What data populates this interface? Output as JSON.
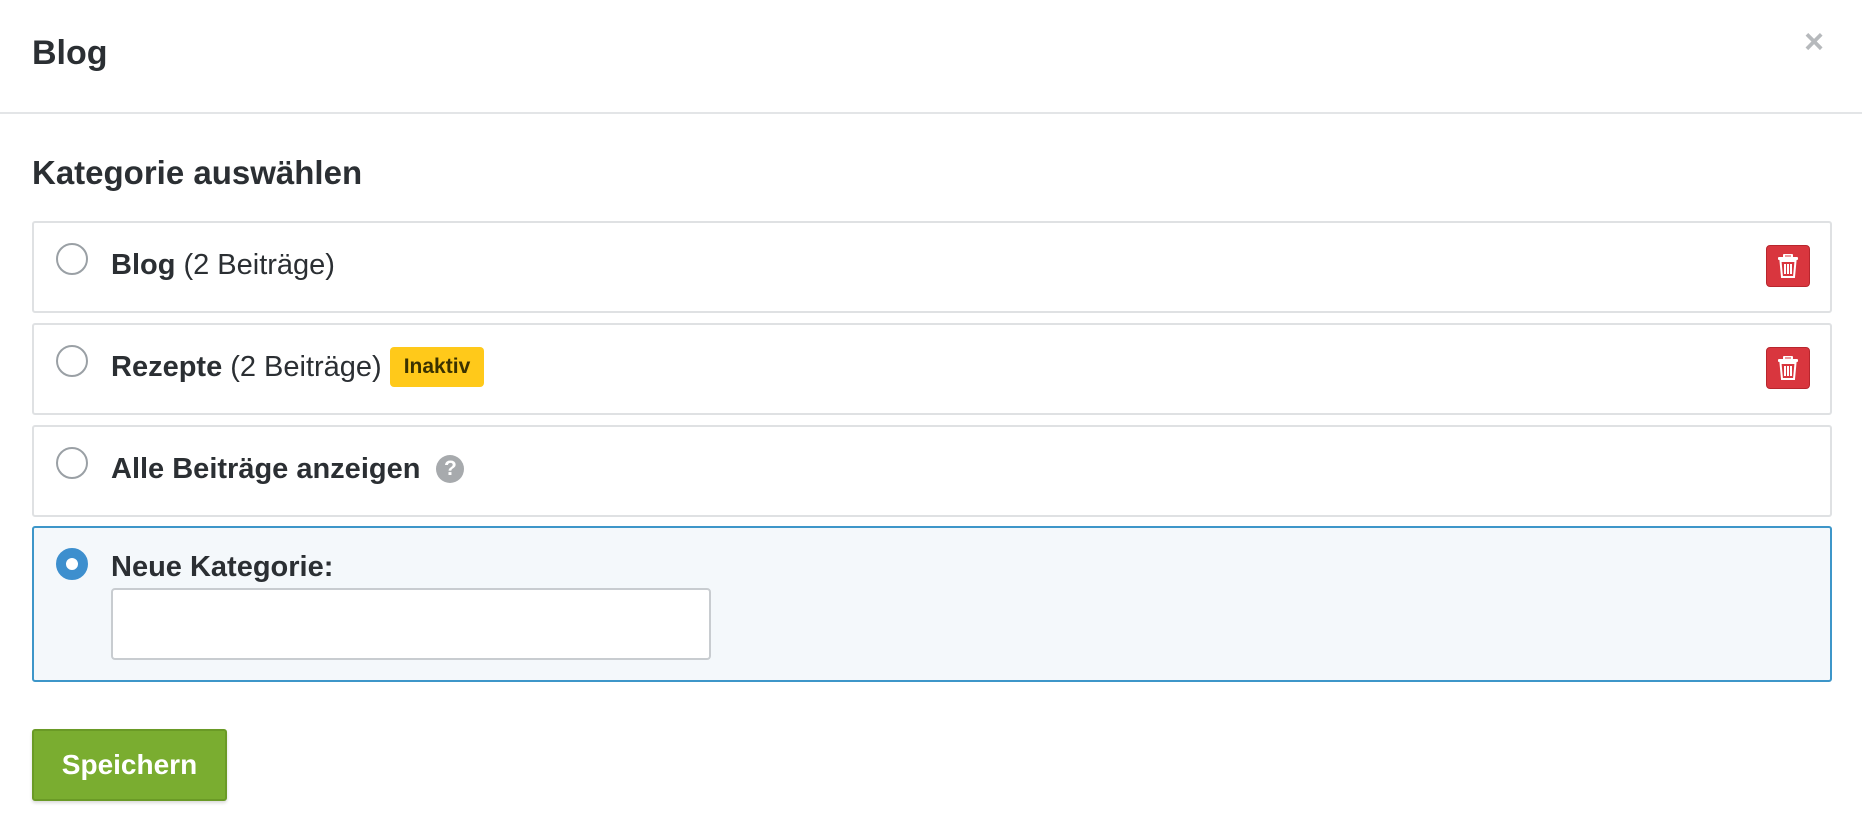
{
  "modal": {
    "title": "Blog",
    "close_icon": "close-icon",
    "close_symbol": "×"
  },
  "section": {
    "heading": "Kategorie auswählen"
  },
  "options": [
    {
      "name": "Blog",
      "count": "(2 Beiträge)",
      "selected": false,
      "deletable": true
    },
    {
      "name": "Rezepte",
      "count": "(2 Beiträge)",
      "badge": "Inaktiv",
      "selected": false,
      "deletable": true
    },
    {
      "name": "Alle Beiträge anzeigen",
      "help": "?",
      "selected": false,
      "deletable": false
    },
    {
      "name": "Neue Kategorie:",
      "selected": true,
      "input_value": "",
      "input_placeholder": ""
    }
  ],
  "save_label": "Speichern",
  "colors": {
    "delete": "#d9363e",
    "badge": "#ffc91a",
    "selected_border": "#3d96c9",
    "save": "#7aad30"
  }
}
